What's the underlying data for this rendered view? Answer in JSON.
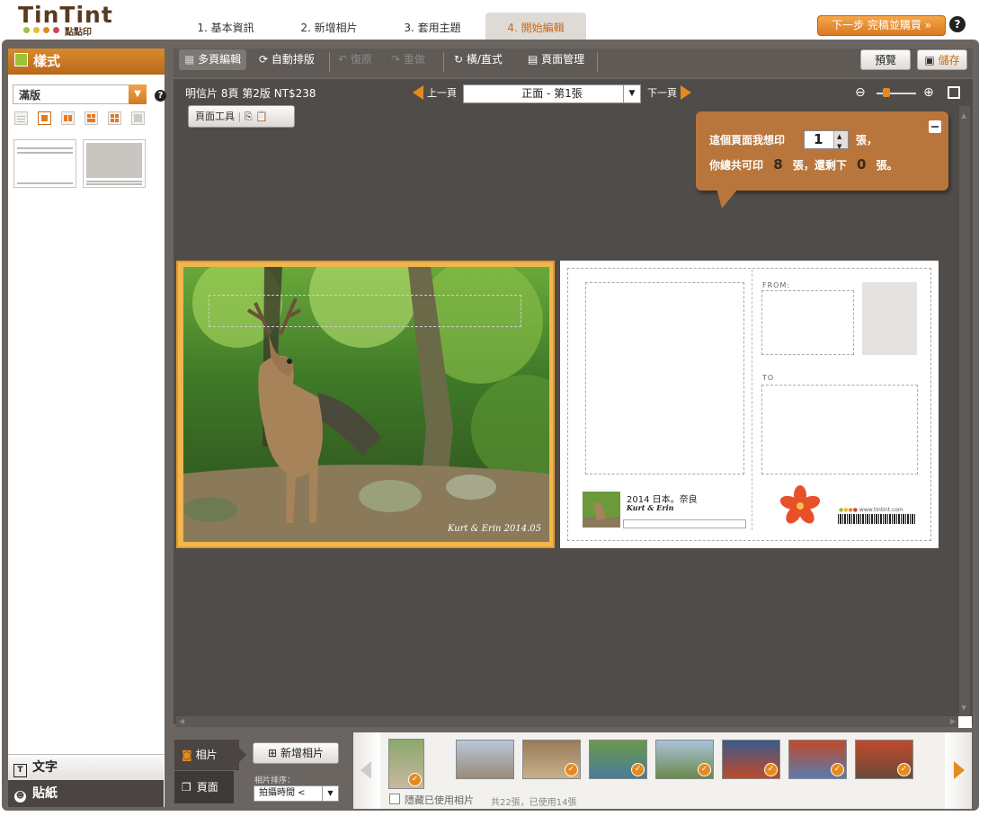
{
  "logo": {
    "name": "TinTint",
    "sub": "點點印",
    "dot_colors": [
      "#9ac43a",
      "#e9b93a",
      "#e58a1e",
      "#c94a4a"
    ]
  },
  "steps": [
    {
      "label": "1. 基本資訊"
    },
    {
      "label": "2. 新增相片"
    },
    {
      "label": "3. 套用主題"
    },
    {
      "label": "4. 開始編輯"
    }
  ],
  "next_button": "下一步 完稿並購買 »",
  "help": "?",
  "left_panel": {
    "title": "樣式",
    "layout_value": "滿版",
    "text_tab": "文字",
    "sticker_tab": "貼紙"
  },
  "toolbar": {
    "multi_edit": "多頁編輯",
    "auto_layout": "自動排版",
    "undo": "復原",
    "redo": "重做",
    "orientation": "橫/直式",
    "page_manage": "頁面管理",
    "preview": "預覽",
    "save": "儲存"
  },
  "workspace": {
    "info": "明信片 8頁 第2版 NT$238",
    "prev": "上一頁",
    "next": "下一頁",
    "page_value": "正面 - 第1張",
    "page_tools": "頁面工具"
  },
  "bubble": {
    "line1_a": "這個頁面我想印",
    "qty": "1",
    "line1_b": "張，",
    "line2_a": "你總共可印",
    "total": "8",
    "line2_b": "張，還剩下",
    "remaining": "0",
    "line2_c": "張。"
  },
  "postcard": {
    "from": "FROM:",
    "to": "TO",
    "caption": "2014 日本。奈良",
    "signature": "Kurt & Erin",
    "photo_signature": "Kurt & Erin 2014.05",
    "website": "www.tintint.com"
  },
  "bottom": {
    "photo_tab": "相片",
    "page_tab": "頁面",
    "add_photo": "新增相片",
    "sort_label": "相片排序：",
    "sort_value": "拍攝時間 <",
    "hide_used": "隱藏已使用相片",
    "count": "共22張，已使用14張"
  },
  "colors": {
    "accent": "#e58a1e",
    "header_orange": "#c96a14",
    "dark_bg": "#4f4c4a"
  }
}
